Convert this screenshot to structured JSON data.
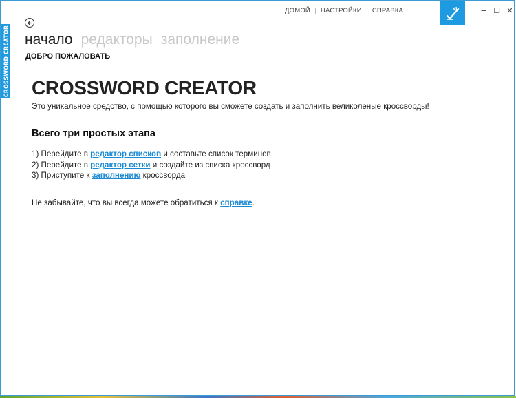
{
  "app": {
    "side_label": "CROSSWORD CREATOR"
  },
  "topnav": {
    "home": "ДОМОЙ",
    "settings": "НАСТРОЙКИ",
    "help": "СПРАВКА"
  },
  "colors": {
    "accent": "#1e9ae0",
    "link": "#1a8ad4"
  },
  "tabs": [
    {
      "label": "начало",
      "active": true
    },
    {
      "label": "редакторы",
      "active": false
    },
    {
      "label": "заполнение",
      "active": false
    }
  ],
  "subnav": {
    "label": "ДОБРО ПОЖАЛОВАТЬ"
  },
  "main": {
    "title": "CROSSWORD CREATOR",
    "intro": "Это уникальное средство, с помощью которого вы сможете создать и заполнить великоленые кроссворды!",
    "steps_heading": "Всего три простых этапа",
    "steps": [
      {
        "before": "1) Перейдите в ",
        "link": "редактор списков",
        "after": " и составьте список терминов"
      },
      {
        "before": "2) Перейдите в ",
        "link": "редактор сетки",
        "after": " и создайте из списка кроссворд"
      },
      {
        "before": "3) Приступите к ",
        "link": "заполнению",
        "after": " кроссворда"
      }
    ],
    "help": {
      "before": "Не забывайте, что вы всегда можете обратиться к ",
      "link": "справке",
      "after": "."
    }
  },
  "window_controls": {
    "minimize": "−",
    "maximize": "☐",
    "close": "✕"
  }
}
